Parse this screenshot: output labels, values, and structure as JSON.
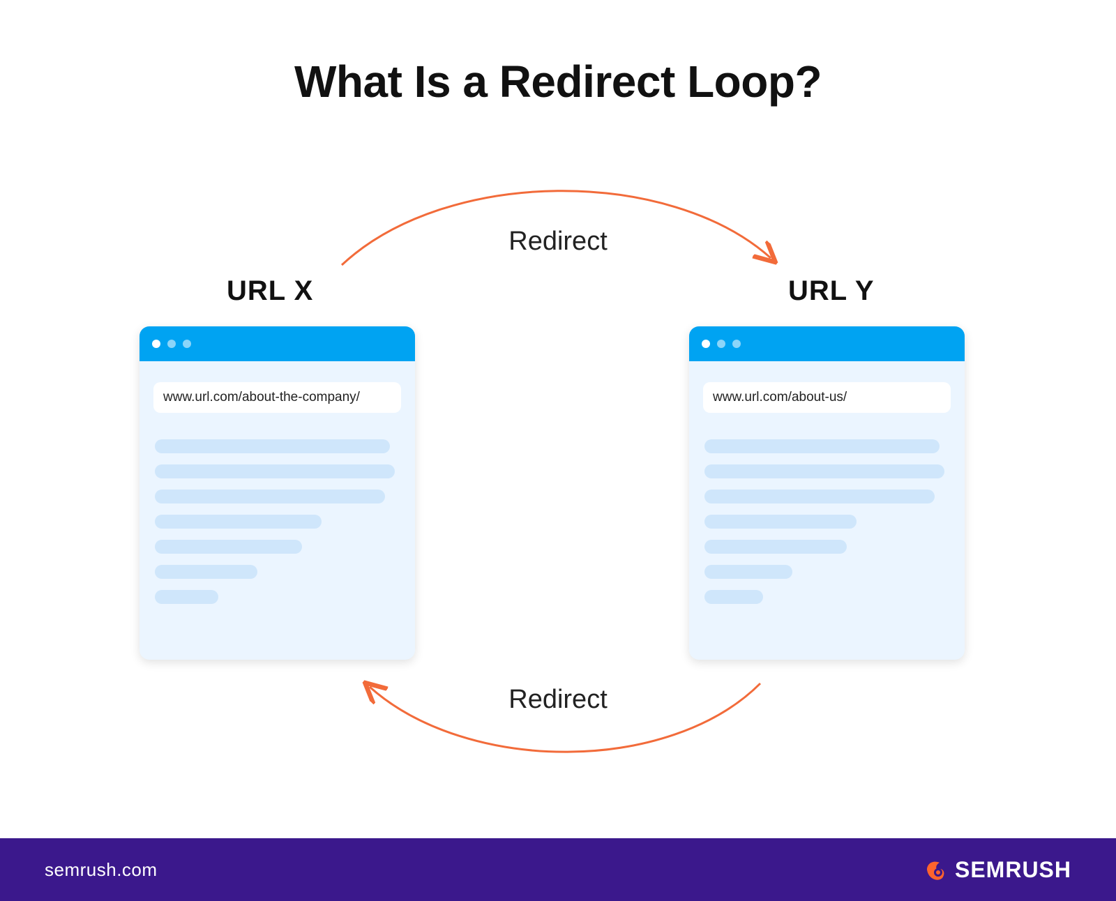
{
  "title": "What Is a Redirect Loop?",
  "arrows": {
    "top_label": "Redirect",
    "bottom_label": "Redirect"
  },
  "left": {
    "label": "URL  X",
    "url": "www.url.com/about-the-company/"
  },
  "right": {
    "label": "URL Y",
    "url": "www.url.com/about-us/"
  },
  "footer": {
    "domain": "semrush.com",
    "brand": "SEMRUSH"
  },
  "colors": {
    "arrow": "#f26b3a",
    "footer_bg": "#3b188c",
    "browser_bar": "#00a3f2"
  }
}
